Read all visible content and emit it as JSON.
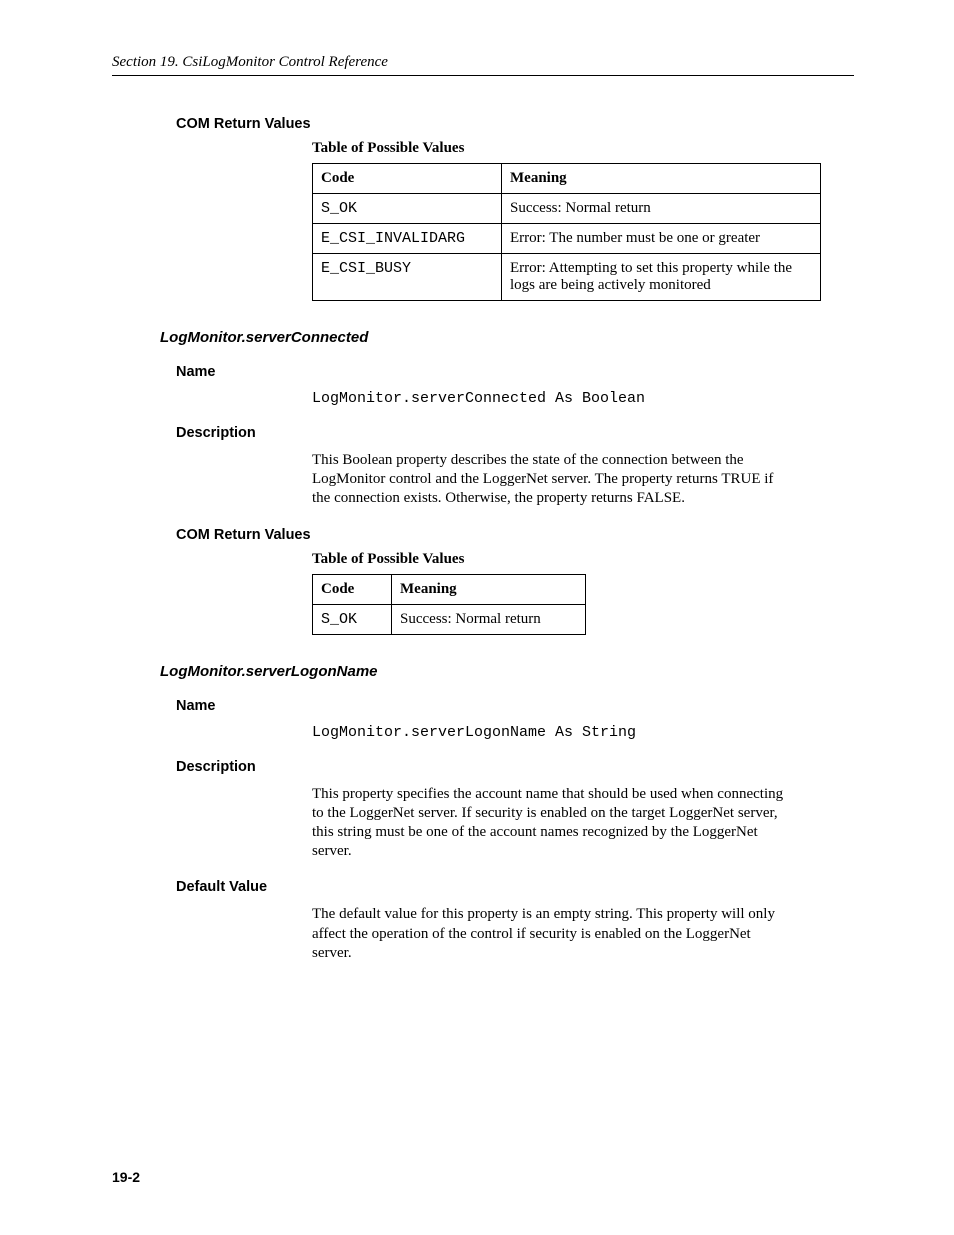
{
  "runningHead": "Section 19.  CsiLogMonitor Control Reference",
  "pageNumber": "19-2",
  "block1": {
    "heading": "COM Return Values",
    "caption": "Table of Possible Values",
    "headers": {
      "code": "Code",
      "meaning": "Meaning"
    },
    "rows": [
      {
        "code": "S_OK",
        "meaning": "Success: Normal return"
      },
      {
        "code": "E_CSI_INVALIDARG",
        "meaning": "Error: The number must be one or greater"
      },
      {
        "code": "E_CSI_BUSY",
        "meaning": "Error: Attempting to set this property while the logs are being actively monitored"
      }
    ]
  },
  "section1": {
    "title": "LogMonitor.serverConnected",
    "nameLabel": "Name",
    "nameValue": "LogMonitor.serverConnected As Boolean",
    "descLabel": "Description",
    "descText": "This Boolean property describes the state of the connection between the LogMonitor control and the LoggerNet server.  The property returns TRUE if the connection exists.  Otherwise, the property returns FALSE.",
    "comLabel": "COM Return Values",
    "caption": "Table of Possible Values",
    "headers": {
      "code": "Code",
      "meaning": "Meaning"
    },
    "rows": [
      {
        "code": "S_OK",
        "meaning": "Success: Normal return"
      }
    ]
  },
  "section2": {
    "title": "LogMonitor.serverLogonName",
    "nameLabel": "Name",
    "nameValue": "LogMonitor.serverLogonName As String",
    "descLabel": "Description",
    "descText": "This property specifies the account name that should be used when connecting to the LoggerNet server.  If security is enabled on the target LoggerNet server, this string must be one of the account names recognized by the LoggerNet server.",
    "defaultLabel": "Default Value",
    "defaultText": "The default value for this property is an empty string.  This property will only affect the operation of the control if security is enabled on the LoggerNet server."
  }
}
